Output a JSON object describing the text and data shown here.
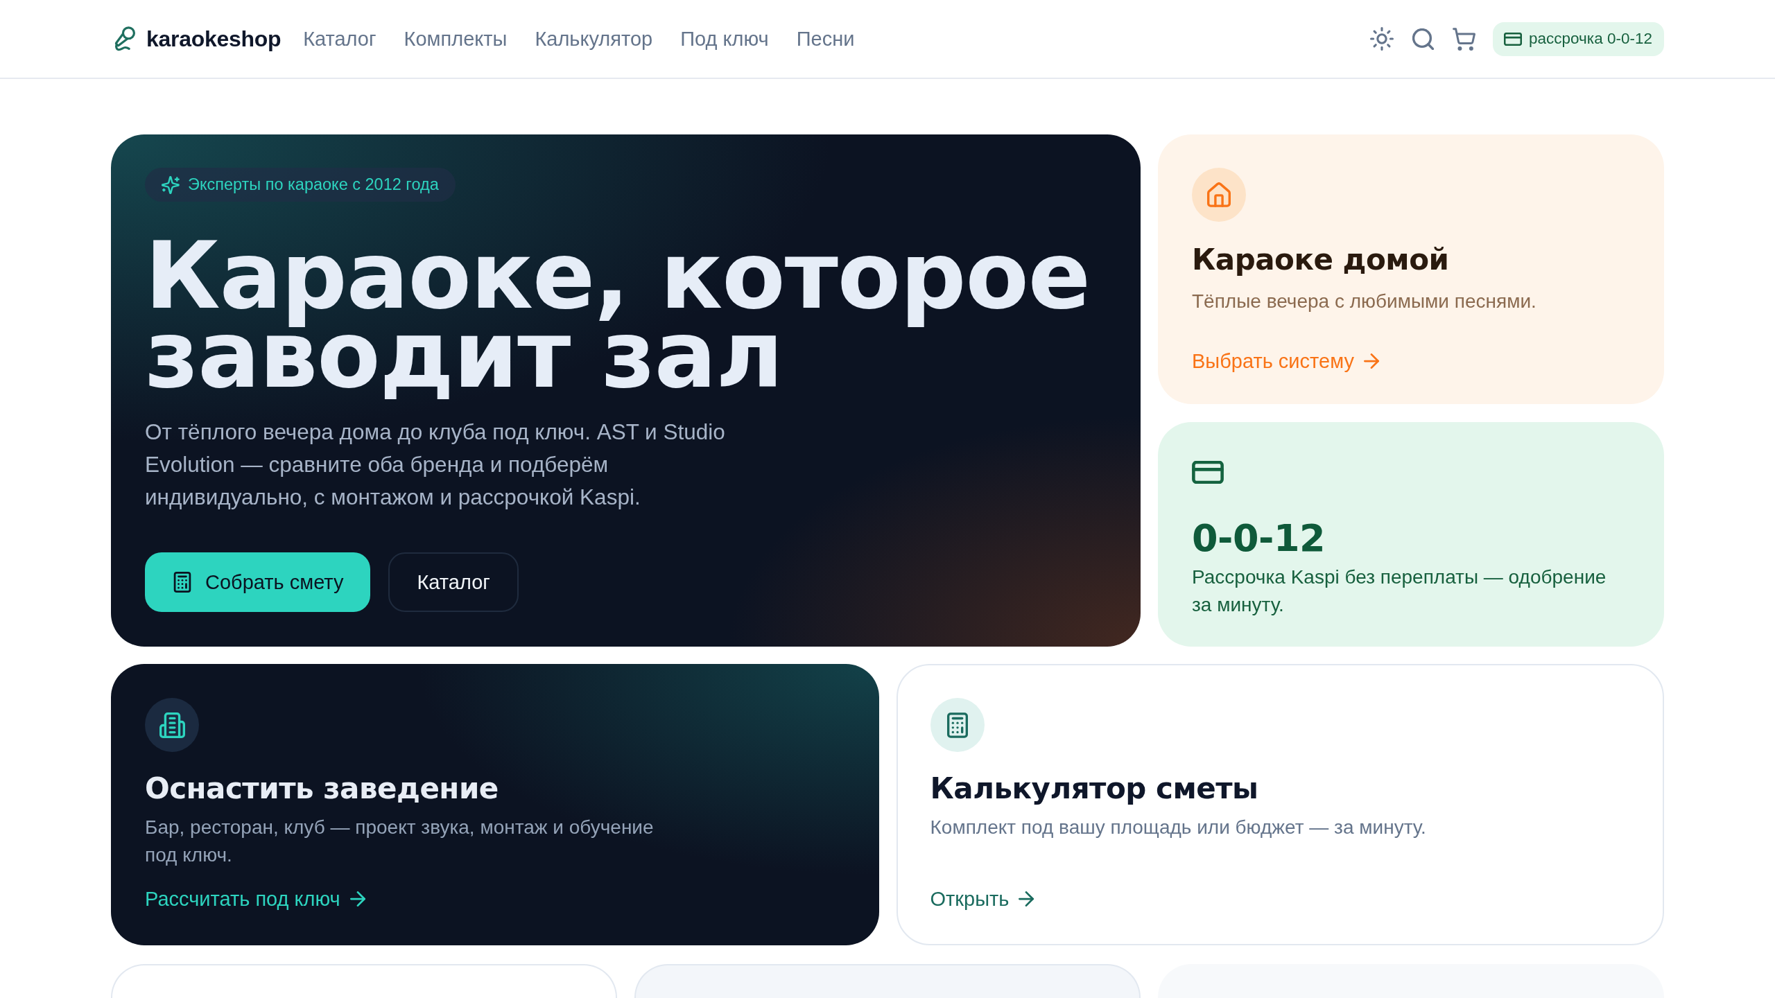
{
  "header": {
    "logo": "karaokeshop",
    "nav": [
      "Каталог",
      "Комплекты",
      "Калькулятор",
      "Под ключ",
      "Песни"
    ],
    "installment_link": "рассрочка 0-0-12"
  },
  "hero": {
    "tag": "Эксперты по караоке с 2012 года",
    "title": "Караоке, которое заводит зал",
    "text": "От тёплого вечера дома до клуба под ключ. AST и Studio Evolution — сравните оба бренда и подберём индивидуально, с монтажом и рассрочкой Kaspi.",
    "buttons": [
      {
        "kind": "primary",
        "label": "Собрать смету"
      },
      {
        "kind": "secondary",
        "label": "Каталог"
      }
    ]
  },
  "side_cards": [
    {
      "kind": "home",
      "title": "Караоке домой",
      "text": "Тёплые вечера с любимыми песнями.",
      "link": "Выбрать систему"
    },
    {
      "kind": "installment",
      "title": "0-0-12",
      "text": "Рассрочка Kaspi без переплаты — одобрение за минуту."
    }
  ],
  "feature_cards": [
    {
      "kind": "venue",
      "title": "Оснастить заведение",
      "text": "Бар, ресторан, клуб — проект звука, монтаж и обучение под ключ.",
      "link": "Рассчитать под ключ"
    },
    {
      "kind": "calculator",
      "title": "Калькулятор сметы",
      "text": "Комплект под вашу площадь или бюджет — за минуту.",
      "link": "Открыть"
    }
  ],
  "lower_cards": [
    {
      "kind": "outlined"
    },
    {
      "kind": "tinted"
    },
    {
      "kind": "plain"
    }
  ]
}
